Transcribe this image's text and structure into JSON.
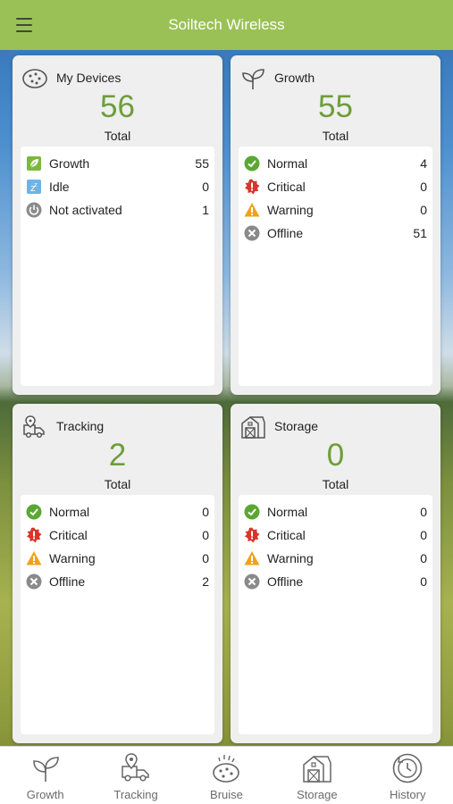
{
  "header": {
    "title": "Soiltech Wireless"
  },
  "cards": {
    "my_devices": {
      "label": "My Devices",
      "total": "56",
      "total_label": "Total",
      "rows": [
        {
          "label": "Growth",
          "value": "55"
        },
        {
          "label": "Idle",
          "value": "0"
        },
        {
          "label": "Not activated",
          "value": "1"
        }
      ]
    },
    "growth": {
      "label": "Growth",
      "total": "55",
      "total_label": "Total",
      "rows": [
        {
          "label": "Normal",
          "value": "4"
        },
        {
          "label": "Critical",
          "value": "0"
        },
        {
          "label": "Warning",
          "value": "0"
        },
        {
          "label": "Offline",
          "value": "51"
        }
      ]
    },
    "tracking": {
      "label": "Tracking",
      "total": "2",
      "total_label": "Total",
      "rows": [
        {
          "label": "Normal",
          "value": "0"
        },
        {
          "label": "Critical",
          "value": "0"
        },
        {
          "label": "Warning",
          "value": "0"
        },
        {
          "label": "Offline",
          "value": "2"
        }
      ]
    },
    "storage": {
      "label": "Storage",
      "total": "0",
      "total_label": "Total",
      "rows": [
        {
          "label": "Normal",
          "value": "0"
        },
        {
          "label": "Critical",
          "value": "0"
        },
        {
          "label": "Warning",
          "value": "0"
        },
        {
          "label": "Offline",
          "value": "0"
        }
      ]
    }
  },
  "footer": {
    "tabs": [
      {
        "label": "Growth",
        "icon": "sprout-icon"
      },
      {
        "label": "Tracking",
        "icon": "truck-icon"
      },
      {
        "label": "Bruise",
        "icon": "potato-icon"
      },
      {
        "label": "Storage",
        "icon": "barn-icon"
      },
      {
        "label": "History",
        "icon": "history-icon"
      }
    ]
  },
  "colors": {
    "header": "#9ac155",
    "accent_green": "#6e9d3b",
    "normal": "#5aa832",
    "critical": "#d9342b",
    "warning": "#f0a11c",
    "offline": "#8a8a8a",
    "idle": "#6db3e8"
  }
}
